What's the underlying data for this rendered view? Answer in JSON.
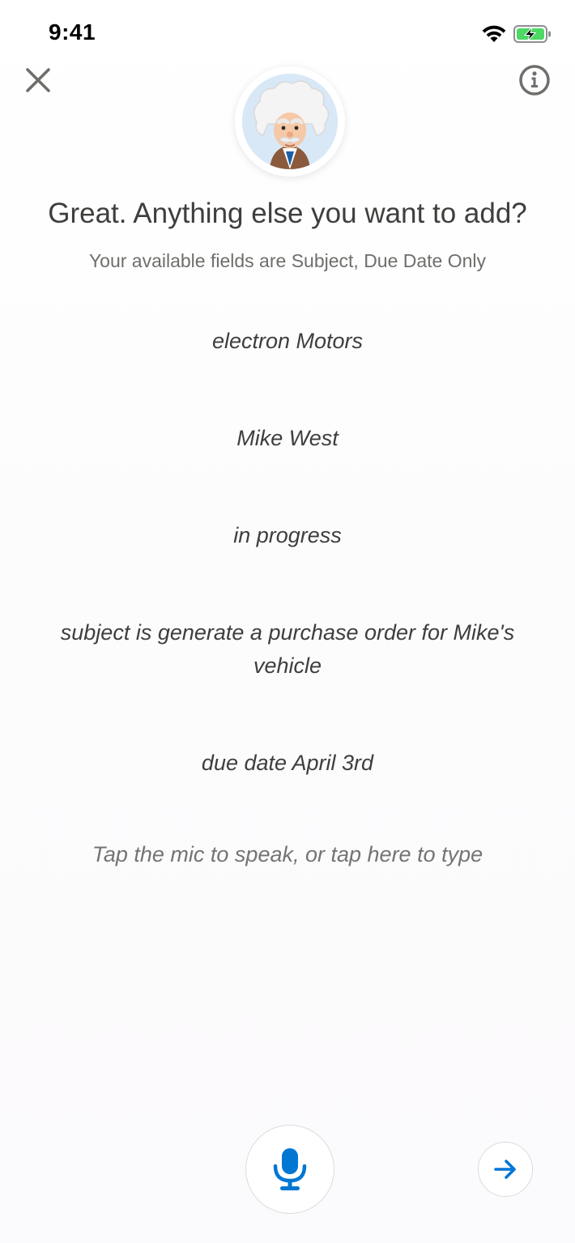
{
  "status_bar": {
    "time": "9:41",
    "icons": [
      "wifi-icon",
      "battery-charging-icon"
    ],
    "battery_color": "#4cd964"
  },
  "header": {
    "close_icon": "close-icon",
    "info_icon": "info-icon",
    "avatar": "einstein-avatar"
  },
  "prompt": {
    "title": "Great. Anything else you want to add?",
    "subtitle": "Your available fields are Subject, Due Date Only"
  },
  "utterances": [
    "electron Motors",
    "Mike West",
    "in progress",
    "subject is generate a purchase order for Mike's vehicle",
    "due date April 3rd"
  ],
  "input": {
    "hint": "Tap the mic to speak, or tap here to type"
  },
  "controls": {
    "mic_icon": "microphone-icon",
    "send_icon": "arrow-right-icon",
    "accent_color": "#0176d3"
  }
}
